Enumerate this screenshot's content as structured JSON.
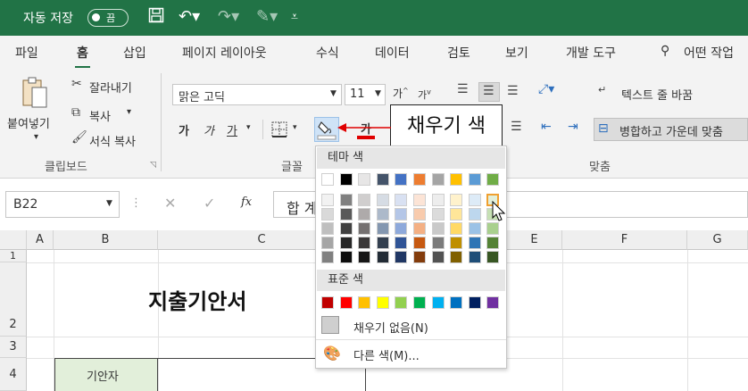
{
  "titlebar": {
    "autosave": "자동 저장",
    "toggle": "끔"
  },
  "tabs": [
    "파일",
    "홈",
    "삽입",
    "페이지 레이아웃",
    "수식",
    "데이터",
    "검토",
    "보기",
    "개발 도구"
  ],
  "search_text": "어떤 작업",
  "clipboard": {
    "paste": "붙여넣기",
    "cut": "잘라내기",
    "copy": "복사",
    "format_painter": "서식 복사",
    "group": "클립보드"
  },
  "font": {
    "name": "맑은 고딕",
    "size": "11",
    "bold": "가",
    "italic": "가",
    "underline": "가",
    "font_color": "가",
    "group": "글꼴",
    "grow": "가",
    "shrink": "가"
  },
  "alignment": {
    "wrap": "텍스트 줄 바꿈",
    "merge": "병합하고 가운데 맞춤",
    "group": "맞춤"
  },
  "formula_bar": {
    "name_box": "B22",
    "fx": "fx",
    "content": "합 계"
  },
  "columns": [
    "A",
    "B",
    "C",
    "E",
    "F",
    "G"
  ],
  "rows": [
    "1",
    "2",
    "3",
    "4"
  ],
  "cells": {
    "title": "지출기안서",
    "drafter": "기안자"
  },
  "dropdown": {
    "theme_label": "테마 색",
    "standard_label": "표준 색",
    "no_fill": "채우기 없음(N)",
    "more_colors": "다른 색(M)...",
    "theme_top": [
      "#FFFFFF",
      "#000000",
      "#E7E6E6",
      "#44546A",
      "#4472C4",
      "#ED7D31",
      "#A5A5A5",
      "#FFC000",
      "#5B9BD5",
      "#70AD47"
    ],
    "theme_shades": [
      [
        "#F2F2F2",
        "#808080",
        "#D0CECE",
        "#D6DCE4",
        "#D9E1F2",
        "#FCE4D6",
        "#EDEDED",
        "#FFF2CC",
        "#DDEBF7",
        "#E2EFDA"
      ],
      [
        "#D9D9D9",
        "#595959",
        "#AEAAAA",
        "#ACB9CA",
        "#B4C6E7",
        "#F8CBAD",
        "#DBDBDB",
        "#FFE699",
        "#BDD7EE",
        "#C6E0B4"
      ],
      [
        "#BFBFBF",
        "#404040",
        "#757171",
        "#8497B0",
        "#8EA9DB",
        "#F4B084",
        "#C9C9C9",
        "#FFD966",
        "#9BC2E6",
        "#A9D08E"
      ],
      [
        "#A6A6A6",
        "#262626",
        "#3A3838",
        "#333F4F",
        "#305496",
        "#C65911",
        "#7B7B7B",
        "#BF8F00",
        "#2F75B5",
        "#548235"
      ],
      [
        "#808080",
        "#0D0D0D",
        "#171616",
        "#222B35",
        "#203764",
        "#833C0C",
        "#525252",
        "#806000",
        "#1F4E78",
        "#375623"
      ]
    ],
    "standard": [
      "#C00000",
      "#FF0000",
      "#FFC000",
      "#FFFF00",
      "#92D050",
      "#00B050",
      "#00B0F0",
      "#0070C0",
      "#002060",
      "#7030A0"
    ]
  },
  "callout": "채우기 색",
  "colors": {
    "excel_green": "#217346",
    "drafter_fill": "#E2EFDA"
  }
}
